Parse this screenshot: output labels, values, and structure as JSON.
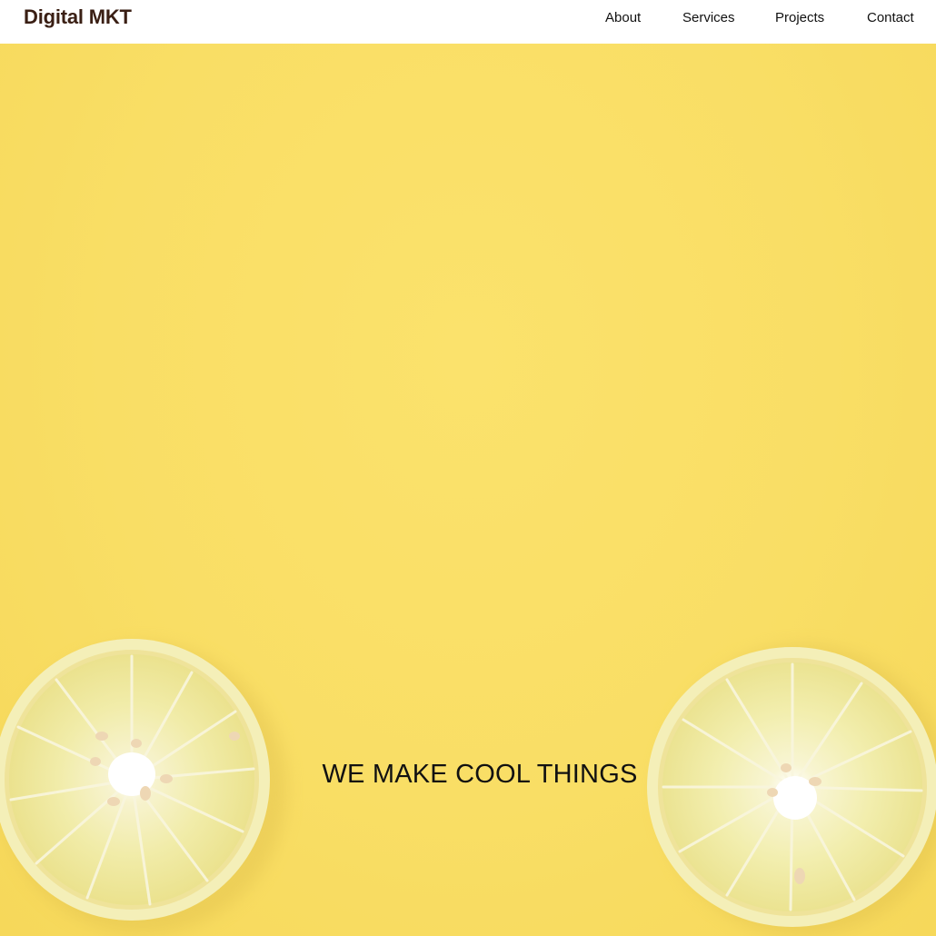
{
  "header": {
    "brand": "Digital MKT",
    "nav": [
      {
        "label": "About"
      },
      {
        "label": "Services"
      },
      {
        "label": "Projects"
      },
      {
        "label": "Contact"
      }
    ]
  },
  "hero": {
    "title": "WE MAKE COOL THINGS",
    "background_color": "#f9de65",
    "image_subject": "lemon-slices"
  },
  "colors": {
    "brand": "#3a1f14",
    "nav_text": "#111111",
    "hero_text": "#111111"
  }
}
